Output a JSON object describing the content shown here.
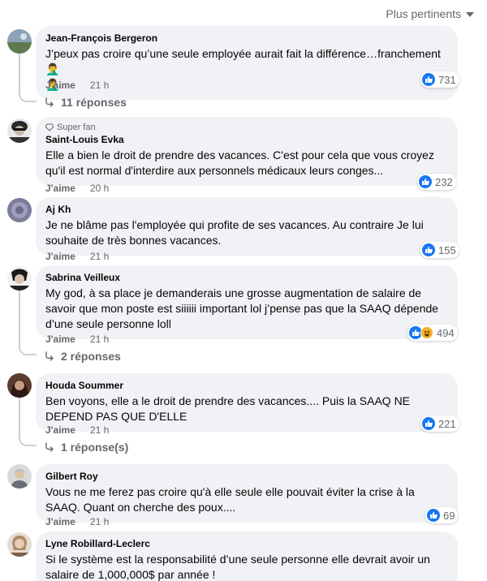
{
  "sort": {
    "label": "Plus pertinents"
  },
  "meta_labels": {
    "like": "J'aime"
  },
  "comments": [
    {
      "author": "Jean-François Bergeron",
      "text": "J’peux pas croire qu’une seule employée aurait fait la différence…franchement 🤦‍♂️\n🤦‍♂️",
      "time": "21 h",
      "reactions": {
        "count": "731",
        "types": [
          "like"
        ]
      },
      "replies": "11 réponses"
    },
    {
      "badge": "Super fan",
      "author": "Saint-Louis Evka",
      "text": "Elle a bien le droit de prendre des vacances. C'est pour cela que vous croyez qu'il est normal d'interdire aux personnels médicaux leurs conges...",
      "time": "20 h",
      "reactions": {
        "count": "232",
        "types": [
          "like"
        ]
      }
    },
    {
      "author": "Aj Kh",
      "text": "Je ne blâme pas l'employée qui profite de ses vacances. Au contraire Je lui souhaite de très bonnes vacances.",
      "time": "21 h",
      "reactions": {
        "count": "155",
        "types": [
          "like"
        ]
      }
    },
    {
      "author": "Sabrina Veilleux",
      "text": "My god, à sa place je demanderais une grosse augmentation de salaire de savoir que mon poste est siiiiii important lol j’pense pas que la SAAQ dépende d’une seule personne loll",
      "time": "21 h",
      "reactions": {
        "count": "494",
        "types": [
          "like",
          "haha"
        ]
      },
      "replies": "2 réponses"
    },
    {
      "author": "Houda Soummer",
      "text": "Ben voyons, elle a le droit de prendre des vacances.... Puis la SAAQ NE DEPEND PAS QUE D'ELLE",
      "time": "21 h",
      "reactions": {
        "count": "221",
        "types": [
          "like"
        ]
      },
      "replies": "1 réponse(s)"
    },
    {
      "author": "Gilbert Roy",
      "text": "Vous ne me ferez pas croire qu'à elle seule elle pouvait éviter la crise à la SAAQ. Quant on cherche des poux....",
      "time": "21 h",
      "reactions": {
        "count": "69",
        "types": [
          "like"
        ]
      }
    },
    {
      "author": "Lyne Robillard-Leclerc",
      "text": "Si le système est la responsabilité d’une seule personne elle devrait avoir un salaire de 1,000,000$ par année !",
      "time": "",
      "reactions": {
        "count": "",
        "types": []
      }
    }
  ]
}
